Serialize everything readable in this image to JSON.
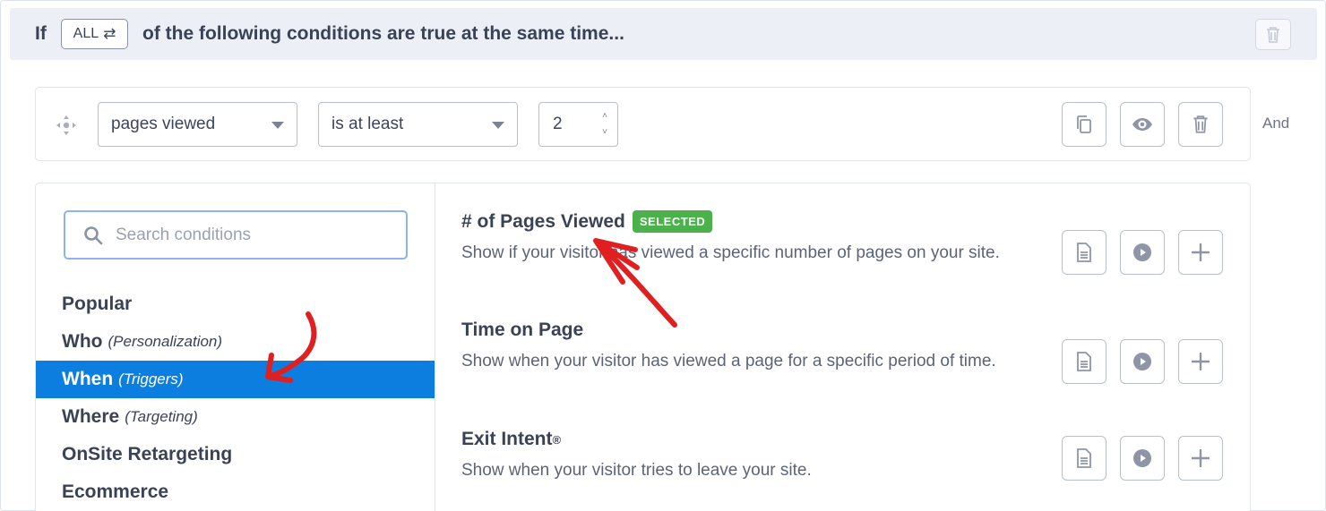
{
  "header": {
    "if_label": "If",
    "toggle_label": "ALL",
    "toggle_icon": "swap-arrows-icon",
    "text": "of the following conditions are true at the same time...",
    "delete_icon": "trash-icon"
  },
  "condition": {
    "field": "pages viewed",
    "operator": "is at least",
    "value": "2",
    "spin_up": "˄",
    "spin_down": "˅",
    "actions": [
      "copy-icon",
      "eye-icon",
      "trash-icon"
    ],
    "connector": "And"
  },
  "picker": {
    "search_placeholder": "Search conditions",
    "categories": [
      {
        "label": "Popular",
        "sub": ""
      },
      {
        "label": "Who",
        "sub": "(Personalization)"
      },
      {
        "label": "When",
        "sub": "(Triggers)",
        "active": true
      },
      {
        "label": "Where",
        "sub": "(Targeting)"
      },
      {
        "label": "OnSite Retargeting",
        "sub": ""
      },
      {
        "label": "Ecommerce",
        "sub": ""
      }
    ],
    "items": [
      {
        "title": "# of Pages Viewed",
        "badge": "SELECTED",
        "desc": "Show if your visitor has viewed a specific number of pages on your site."
      },
      {
        "title": "Time on Page",
        "badge": "",
        "desc": "Show when your visitor has viewed a page for a specific period of time."
      },
      {
        "title": "Exit Intent",
        "title_sup": "®",
        "badge": "",
        "desc": "Show when your visitor tries to leave your site."
      }
    ],
    "item_actions": [
      "document-icon",
      "play-icon",
      "plus-icon"
    ]
  },
  "colors": {
    "accent": "#0b7ee0",
    "badge": "#4bb24b",
    "annotation": "#e02020",
    "header_bg": "#eceff6"
  }
}
